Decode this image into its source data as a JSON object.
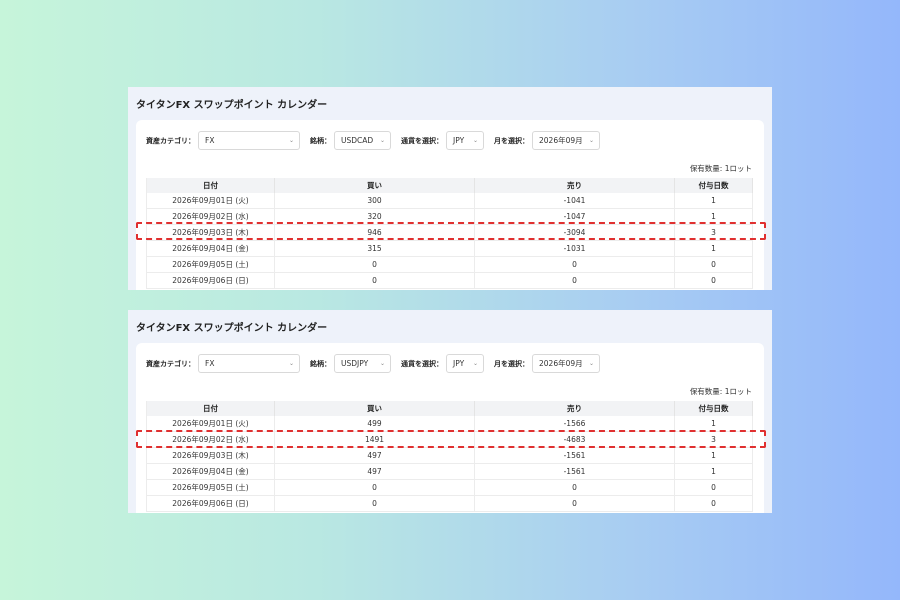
{
  "labels": {
    "title": "タイタンFX スワップポイント カレンダー",
    "asset_category": "資産カテゴリ：",
    "symbol": "銘柄：",
    "currency": "通貨を選択：",
    "month": "月を選択：",
    "holding": "保有数量: 1ロット"
  },
  "table_headers": [
    "日付",
    "買い",
    "売り",
    "付与日数"
  ],
  "panels": [
    {
      "filters": {
        "asset_category": "FX",
        "symbol": "USDCAD",
        "currency": "JPY",
        "month": "2026年09月"
      },
      "highlight_row": 2,
      "rows": [
        [
          "2026年09月01日 (火)",
          "300",
          "-1041",
          "1"
        ],
        [
          "2026年09月02日 (水)",
          "320",
          "-1047",
          "1"
        ],
        [
          "2026年09月03日 (木)",
          "946",
          "-3094",
          "3"
        ],
        [
          "2026年09月04日 (金)",
          "315",
          "-1031",
          "1"
        ],
        [
          "2026年09月05日 (土)",
          "0",
          "0",
          "0"
        ],
        [
          "2026年09月06日 (日)",
          "0",
          "0",
          "0"
        ]
      ]
    },
    {
      "filters": {
        "asset_category": "FX",
        "symbol": "USDJPY",
        "currency": "JPY",
        "month": "2026年09月"
      },
      "highlight_row": 1,
      "rows": [
        [
          "2026年09月01日 (火)",
          "499",
          "-1566",
          "1"
        ],
        [
          "2026年09月02日 (水)",
          "1491",
          "-4683",
          "3"
        ],
        [
          "2026年09月03日 (木)",
          "497",
          "-1561",
          "1"
        ],
        [
          "2026年09月04日 (金)",
          "497",
          "-1561",
          "1"
        ],
        [
          "2026年09月05日 (土)",
          "0",
          "0",
          "0"
        ],
        [
          "2026年09月06日 (日)",
          "0",
          "0",
          "0"
        ]
      ]
    }
  ]
}
